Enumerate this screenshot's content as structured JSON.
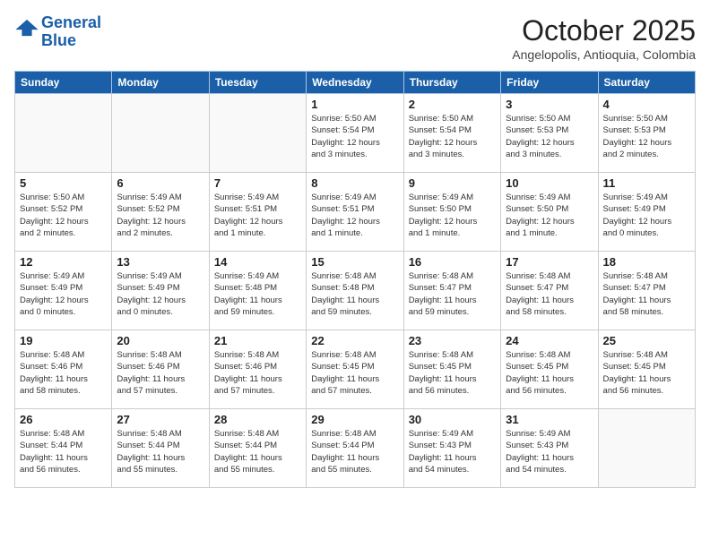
{
  "header": {
    "logo_line1": "General",
    "logo_line2": "Blue",
    "month_title": "October 2025",
    "location": "Angelopolis, Antioquia, Colombia"
  },
  "weekdays": [
    "Sunday",
    "Monday",
    "Tuesday",
    "Wednesday",
    "Thursday",
    "Friday",
    "Saturday"
  ],
  "weeks": [
    [
      {
        "day": "",
        "text": ""
      },
      {
        "day": "",
        "text": ""
      },
      {
        "day": "",
        "text": ""
      },
      {
        "day": "1",
        "text": "Sunrise: 5:50 AM\nSunset: 5:54 PM\nDaylight: 12 hours\nand 3 minutes."
      },
      {
        "day": "2",
        "text": "Sunrise: 5:50 AM\nSunset: 5:54 PM\nDaylight: 12 hours\nand 3 minutes."
      },
      {
        "day": "3",
        "text": "Sunrise: 5:50 AM\nSunset: 5:53 PM\nDaylight: 12 hours\nand 3 minutes."
      },
      {
        "day": "4",
        "text": "Sunrise: 5:50 AM\nSunset: 5:53 PM\nDaylight: 12 hours\nand 2 minutes."
      }
    ],
    [
      {
        "day": "5",
        "text": "Sunrise: 5:50 AM\nSunset: 5:52 PM\nDaylight: 12 hours\nand 2 minutes."
      },
      {
        "day": "6",
        "text": "Sunrise: 5:49 AM\nSunset: 5:52 PM\nDaylight: 12 hours\nand 2 minutes."
      },
      {
        "day": "7",
        "text": "Sunrise: 5:49 AM\nSunset: 5:51 PM\nDaylight: 12 hours\nand 1 minute."
      },
      {
        "day": "8",
        "text": "Sunrise: 5:49 AM\nSunset: 5:51 PM\nDaylight: 12 hours\nand 1 minute."
      },
      {
        "day": "9",
        "text": "Sunrise: 5:49 AM\nSunset: 5:50 PM\nDaylight: 12 hours\nand 1 minute."
      },
      {
        "day": "10",
        "text": "Sunrise: 5:49 AM\nSunset: 5:50 PM\nDaylight: 12 hours\nand 1 minute."
      },
      {
        "day": "11",
        "text": "Sunrise: 5:49 AM\nSunset: 5:49 PM\nDaylight: 12 hours\nand 0 minutes."
      }
    ],
    [
      {
        "day": "12",
        "text": "Sunrise: 5:49 AM\nSunset: 5:49 PM\nDaylight: 12 hours\nand 0 minutes."
      },
      {
        "day": "13",
        "text": "Sunrise: 5:49 AM\nSunset: 5:49 PM\nDaylight: 12 hours\nand 0 minutes."
      },
      {
        "day": "14",
        "text": "Sunrise: 5:49 AM\nSunset: 5:48 PM\nDaylight: 11 hours\nand 59 minutes."
      },
      {
        "day": "15",
        "text": "Sunrise: 5:48 AM\nSunset: 5:48 PM\nDaylight: 11 hours\nand 59 minutes."
      },
      {
        "day": "16",
        "text": "Sunrise: 5:48 AM\nSunset: 5:47 PM\nDaylight: 11 hours\nand 59 minutes."
      },
      {
        "day": "17",
        "text": "Sunrise: 5:48 AM\nSunset: 5:47 PM\nDaylight: 11 hours\nand 58 minutes."
      },
      {
        "day": "18",
        "text": "Sunrise: 5:48 AM\nSunset: 5:47 PM\nDaylight: 11 hours\nand 58 minutes."
      }
    ],
    [
      {
        "day": "19",
        "text": "Sunrise: 5:48 AM\nSunset: 5:46 PM\nDaylight: 11 hours\nand 58 minutes."
      },
      {
        "day": "20",
        "text": "Sunrise: 5:48 AM\nSunset: 5:46 PM\nDaylight: 11 hours\nand 57 minutes."
      },
      {
        "day": "21",
        "text": "Sunrise: 5:48 AM\nSunset: 5:46 PM\nDaylight: 11 hours\nand 57 minutes."
      },
      {
        "day": "22",
        "text": "Sunrise: 5:48 AM\nSunset: 5:45 PM\nDaylight: 11 hours\nand 57 minutes."
      },
      {
        "day": "23",
        "text": "Sunrise: 5:48 AM\nSunset: 5:45 PM\nDaylight: 11 hours\nand 56 minutes."
      },
      {
        "day": "24",
        "text": "Sunrise: 5:48 AM\nSunset: 5:45 PM\nDaylight: 11 hours\nand 56 minutes."
      },
      {
        "day": "25",
        "text": "Sunrise: 5:48 AM\nSunset: 5:45 PM\nDaylight: 11 hours\nand 56 minutes."
      }
    ],
    [
      {
        "day": "26",
        "text": "Sunrise: 5:48 AM\nSunset: 5:44 PM\nDaylight: 11 hours\nand 56 minutes."
      },
      {
        "day": "27",
        "text": "Sunrise: 5:48 AM\nSunset: 5:44 PM\nDaylight: 11 hours\nand 55 minutes."
      },
      {
        "day": "28",
        "text": "Sunrise: 5:48 AM\nSunset: 5:44 PM\nDaylight: 11 hours\nand 55 minutes."
      },
      {
        "day": "29",
        "text": "Sunrise: 5:48 AM\nSunset: 5:44 PM\nDaylight: 11 hours\nand 55 minutes."
      },
      {
        "day": "30",
        "text": "Sunrise: 5:49 AM\nSunset: 5:43 PM\nDaylight: 11 hours\nand 54 minutes."
      },
      {
        "day": "31",
        "text": "Sunrise: 5:49 AM\nSunset: 5:43 PM\nDaylight: 11 hours\nand 54 minutes."
      },
      {
        "day": "",
        "text": ""
      }
    ]
  ]
}
